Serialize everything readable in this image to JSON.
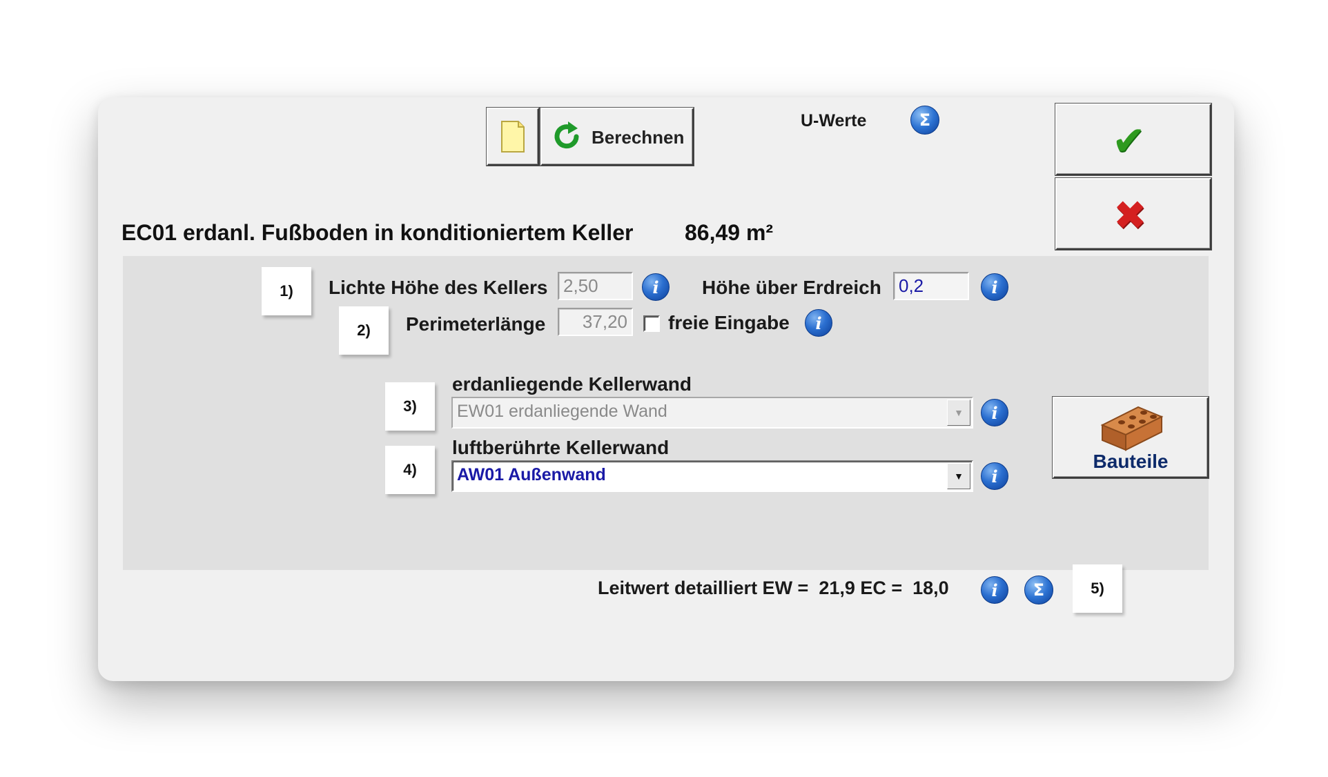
{
  "toolbar": {
    "calc_label": "Berechnen",
    "u_werte_label": "U-Werte"
  },
  "header": {
    "title": "EC01 erdanl. Fußboden in konditioniertem Keller",
    "area": "86,49 m²"
  },
  "steps": {
    "s1": "1)",
    "s2": "2)",
    "s3": "3)",
    "s4": "4)",
    "s5": "5)"
  },
  "fields": {
    "height_label": "Lichte Höhe des Kellers",
    "height_value": "2,50",
    "above_ground_label": "Höhe über Erdreich",
    "above_ground_value": "0,2",
    "perimeter_label": "Perimeterlänge",
    "perimeter_value": "37,20",
    "free_entry_label": "freie Eingabe",
    "free_entry_checked": false
  },
  "walls": {
    "ground_wall_label": "erdanliegende Kellerwand",
    "ground_wall_value": "EW01  erdanliegende Wand",
    "air_wall_label": "luftberührte Kellerwand",
    "air_wall_value": "AW01  Außenwand"
  },
  "bauteile_label": "Bauteile",
  "footer": {
    "text": "Leitwert detailliert EW =  21,9 EC =  18,0"
  },
  "icons": {
    "info": "i",
    "sigma": "Σ",
    "ok": "✔",
    "cancel": "✖",
    "dropdown": "▼"
  },
  "colors": {
    "accent_blue": "#0d3f99",
    "value_blue": "#1a1aa6",
    "ok_green": "#2e9a1f",
    "cancel_red": "#d42020"
  }
}
